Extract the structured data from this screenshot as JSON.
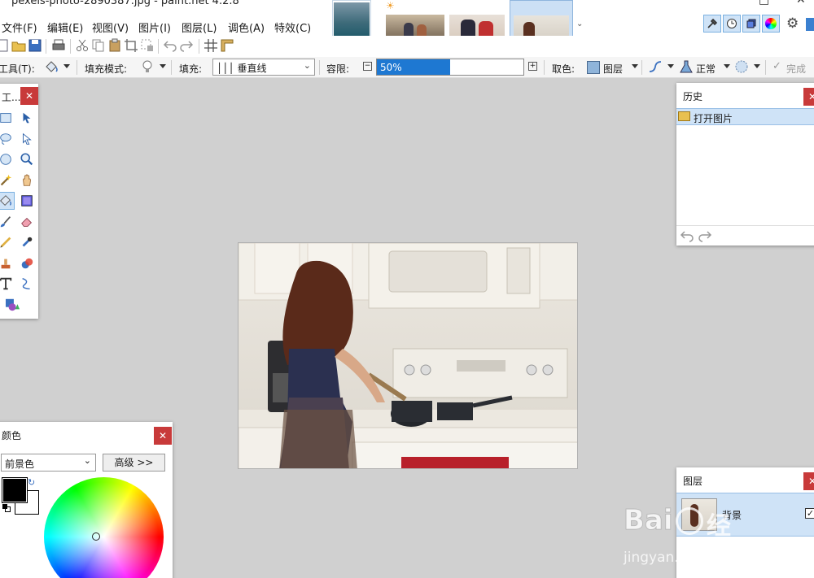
{
  "window": {
    "title": "pexels-photo-2890387.jpg - paint.net 4.2.8",
    "minimize": "—",
    "maximize": "□",
    "close": "✕"
  },
  "menu": [
    "文件(F)",
    "编辑(E)",
    "视图(V)",
    "图片(I)",
    "图层(L)",
    "调色(A)",
    "特效(C)"
  ],
  "thumbnails": [
    "aerial-island",
    "sunburst",
    "couple-sitting",
    "couple-selfie",
    "kitchen-woman"
  ],
  "toolbar": {
    "tool_label": "工具(T):",
    "fill_mode_label": "填充模式:",
    "fill_label": "填充:",
    "fill_value": "│││ 垂直线",
    "tolerance_label": "容限:",
    "tolerance_text": "50%",
    "tolerance_fraction": 0.5,
    "sampling_label": "取色:",
    "sampling_value": "图层",
    "blend_value": "正常",
    "done_label": "完成"
  },
  "tools_panel": {
    "title": "工...",
    "tools": [
      [
        "rectangle-select-icon",
        "move-selection-icon"
      ],
      [
        "lasso-select-icon",
        "move-selected-icon"
      ],
      [
        "ellipse-select-icon",
        "zoom-icon"
      ],
      [
        "magic-wand-icon",
        "pan-hand-icon"
      ],
      [
        "paint-bucket-icon",
        "gradient-icon"
      ],
      [
        "paintbrush-icon",
        "eraser-icon"
      ],
      [
        "pencil-icon",
        "color-picker-icon"
      ],
      [
        "clone-stamp-icon",
        "recolor-icon"
      ],
      [
        "text-icon",
        "line-curve-icon"
      ],
      [
        "shapes-icon",
        ""
      ]
    ]
  },
  "history_panel": {
    "title": "历史",
    "items": [
      "打开图片"
    ]
  },
  "colors_panel": {
    "title": "颜色",
    "select_value": "前景色",
    "advanced_button": "高级 >>",
    "primary": "#000000",
    "secondary": "#ffffff"
  },
  "layers_panel": {
    "title": "图层",
    "layer_name": "背景",
    "layer_visible": true
  },
  "watermark": {
    "brand": "Bai",
    "brand_tail": "经验",
    "url": "jingyan.baidu.com"
  }
}
